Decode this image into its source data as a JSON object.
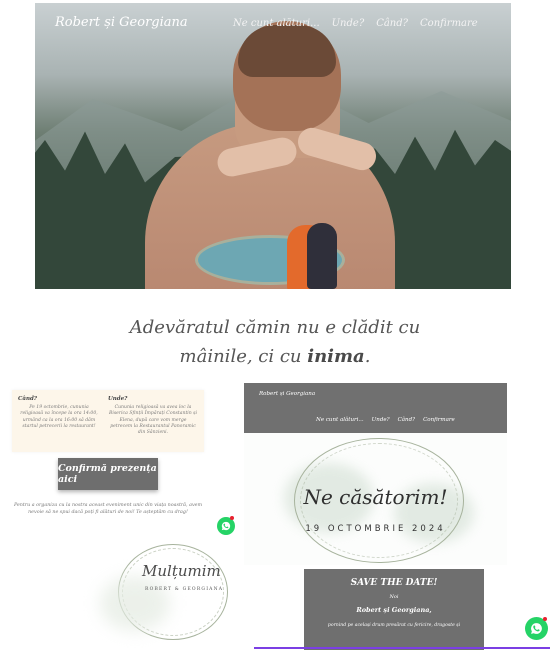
{
  "hero": {
    "brand": "Robert și Georgiana",
    "nav": [
      "Ne cunt alături...",
      "Unde?",
      "Când?",
      "Confirmare"
    ]
  },
  "quote": {
    "line1": "Adevăratul cămin nu e clădit cu",
    "line2_start": "mâinile, ci cu ",
    "line2_bold": "inima",
    "line2_end": "."
  },
  "info_card": {
    "col1_title": "Când?",
    "col1_text": "Pe 19 octombrie, cununia religioasă va începe la ora 14:00, urmând ca la ora 16:00 să dăm startul petrecerii la restaurant!",
    "col2_title": "Unde?",
    "col2_text": "Cununia religioasă va avea loc la Biserica Sfinții Împărați Constantin și Elena, după care vom merge petrecem la Restaurantul Panoramic din Sânzieni."
  },
  "confirm_button": "Confirmă prezența aici",
  "left_note": "Pentru a organiza cu la nostra aceast eveniment unic din viața noastră, avem nevoie să ne spui dacă poți fi alături de noi! Te așteptăm cu drag!",
  "thanks_card": {
    "title": "Mulțumim",
    "names": "ROBERT & GEORGIANA"
  },
  "preview": {
    "brand": "Robert și Georgiana",
    "nav": [
      "Ne cunt alături...",
      "Unde?",
      "Când?",
      "Confirmare"
    ],
    "title": "Ne căsătorim!",
    "date": "19 OCTOMBRIE 2024",
    "save_title": "SAVE THE DATE!",
    "save_noi": "Noi",
    "save_names": "Robert și Georgiana,",
    "save_desc": "pornind pe același drum presărat cu fericire, dragoste și"
  },
  "colors": {
    "whatsapp": "#25d366",
    "notification": "#e8202f",
    "accent_line": "#7b3fe4"
  }
}
